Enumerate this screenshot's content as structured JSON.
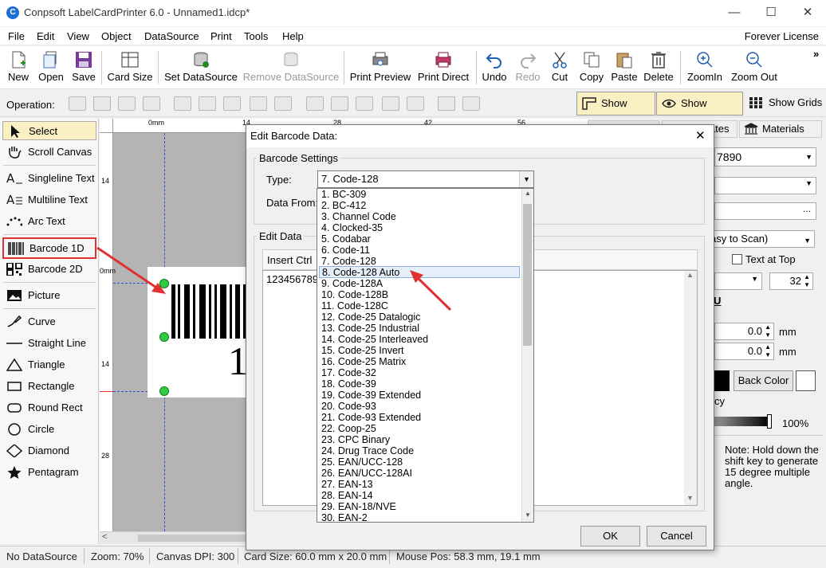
{
  "window": {
    "title": "Conpsoft LabelCardPrinter 6.0 - Unnamed1.idcp*",
    "minimize": "—",
    "maximize": "☐",
    "close": "✕"
  },
  "menubar": {
    "items": [
      "File",
      "Edit",
      "View",
      "Object",
      "DataSource",
      "Print",
      "Tools",
      "Help"
    ],
    "license": "Forever License"
  },
  "toolbar": {
    "buttons": [
      {
        "label": "New",
        "icon": "new-document-icon",
        "enabled": true
      },
      {
        "label": "Open",
        "icon": "open-folder-icon",
        "enabled": true
      },
      {
        "label": "Save",
        "icon": "save-disk-icon",
        "enabled": true
      },
      {
        "label": "Card Size",
        "icon": "card-size-icon",
        "enabled": true
      },
      {
        "label": "Set DataSource",
        "icon": "database-icon",
        "enabled": true
      },
      {
        "label": "Remove DataSource",
        "icon": "database-remove-icon",
        "enabled": false
      },
      {
        "label": "Print Preview",
        "icon": "print-preview-icon",
        "enabled": true
      },
      {
        "label": "Print Direct",
        "icon": "printer-icon",
        "enabled": true
      },
      {
        "label": "Undo",
        "icon": "undo-icon",
        "enabled": true
      },
      {
        "label": "Redo",
        "icon": "redo-icon",
        "enabled": false
      },
      {
        "label": "Cut",
        "icon": "scissors-icon",
        "enabled": true
      },
      {
        "label": "Copy",
        "icon": "copy-icon",
        "enabled": true
      },
      {
        "label": "Paste",
        "icon": "paste-icon",
        "enabled": true
      },
      {
        "label": "Delete",
        "icon": "trash-icon",
        "enabled": true
      },
      {
        "label": "ZoomIn",
        "icon": "zoom-in-icon",
        "enabled": true
      },
      {
        "label": "Zoom Out",
        "icon": "zoom-out-icon",
        "enabled": true
      }
    ],
    "overflow": "»"
  },
  "operation": {
    "label": "Operation:",
    "show_ruler": "Show Ruler",
    "show_guides": "Show Guides",
    "show_grids": "Show Grids"
  },
  "tools": [
    {
      "label": "Select",
      "icon": "cursor-arrow-icon",
      "state": "selected"
    },
    {
      "label": "Scroll Canvas",
      "icon": "hand-icon",
      "state": ""
    },
    {
      "label": "Singleline Text",
      "icon": "singleline-text-icon",
      "state": ""
    },
    {
      "label": "Multiline Text",
      "icon": "multiline-text-icon",
      "state": ""
    },
    {
      "label": "Arc Text",
      "icon": "arc-text-icon",
      "state": ""
    },
    {
      "label": "Barcode 1D",
      "icon": "barcode-1d-icon",
      "state": "highlighted"
    },
    {
      "label": "Barcode 2D",
      "icon": "qr-code-icon",
      "state": ""
    },
    {
      "label": "Picture",
      "icon": "picture-icon",
      "state": ""
    },
    {
      "label": "Curve",
      "icon": "curve-pen-icon",
      "state": ""
    },
    {
      "label": "Straight Line",
      "icon": "line-icon",
      "state": ""
    },
    {
      "label": "Triangle",
      "icon": "triangle-icon",
      "state": ""
    },
    {
      "label": "Rectangle",
      "icon": "rectangle-icon",
      "state": ""
    },
    {
      "label": "Round Rect",
      "icon": "round-rect-icon",
      "state": ""
    },
    {
      "label": "Circle",
      "icon": "circle-icon",
      "state": ""
    },
    {
      "label": "Diamond",
      "icon": "diamond-icon",
      "state": ""
    },
    {
      "label": "Pentagram",
      "icon": "star-icon",
      "state": ""
    }
  ],
  "rulers": {
    "top": [
      "0mm",
      "14",
      "28",
      "42",
      "56"
    ],
    "left": [
      "14",
      "0mm",
      "14",
      "28"
    ]
  },
  "canvas": {
    "barcode_digit": "1"
  },
  "right_panel": {
    "tab_templates": "lates",
    "tab_materials": "Materials",
    "value_field": "7890",
    "readability": "asy to Scan)",
    "text_at_top": "Text at Top",
    "font_size": "32",
    "underline": "U",
    "offset_x": "0.0",
    "offset_y": "0.0",
    "unit": "mm",
    "back_color": "Back Color",
    "opacity_label": "cy",
    "opacity_value": "100%",
    "note": "Note: Hold down the shift key to generate 15 degree multiple angle."
  },
  "dialog": {
    "title": "Edit Barcode Data:",
    "close": "✕",
    "barcode_settings": "Barcode Settings",
    "type_label": "Type:",
    "type_value": "7.  Code-128",
    "data_from_label": "Data From:",
    "edit_data": "Edit Data",
    "insert_ctrl": "Insert Ctrl",
    "data_text": "123456789",
    "ok": "OK",
    "cancel": "Cancel",
    "type_options": [
      "1.  BC-309",
      "2.  BC-412",
      "3.  Channel Code",
      "4.  Clocked-35",
      "5.  Codabar",
      "6.  Code-11",
      "7.  Code-128",
      "8.  Code-128 Auto",
      "9.  Code-128A",
      "10.  Code-128B",
      "11.  Code-128C",
      "12.  Code-25 Datalogic",
      "13.  Code-25 Industrial",
      "14.  Code-25 Interleaved",
      "15.  Code-25 Invert",
      "16.  Code-25 Matrix",
      "17.  Code-32",
      "18.  Code-39",
      "19.  Code-39 Extended",
      "20.  Code-93",
      "21.  Code-93 Extended",
      "22.  Coop-25",
      "23.  CPC Binary",
      "24.  Drug Trace Code",
      "25.  EAN/UCC-128",
      "26.  EAN/UCC-128AI",
      "27.  EAN-13",
      "28.  EAN-14",
      "29.  EAN-18/NVE",
      "30.  EAN-2"
    ],
    "hovered_option": "8.  Code-128 Auto"
  },
  "statusbar": {
    "datasource": "No DataSource",
    "zoom": "Zoom: 70%",
    "dpi": "Canvas DPI: 300",
    "card_size": "Card Size: 60.0 mm x 20.0 mm",
    "mouse_pos": "Mouse Pos: 58.3 mm, 19.1 mm"
  },
  "colors": {
    "selection_yellow": "#fbf0c4",
    "annotation_red": "#e03030",
    "handle_green": "#2ecc40",
    "accent_blue": "#1f6fd1"
  }
}
